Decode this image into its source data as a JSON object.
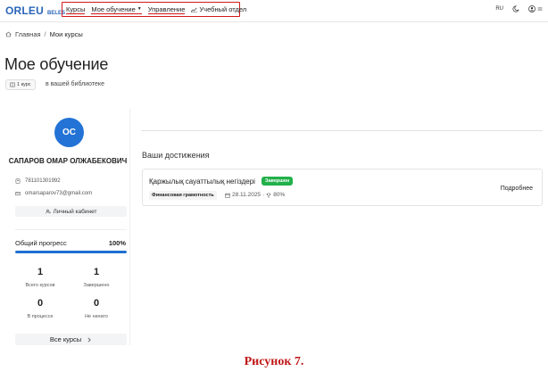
{
  "header": {
    "logo_main": "ORLEU",
    "logo_sub": "BELES",
    "nav": [
      {
        "label": "Курсы"
      },
      {
        "label": "Мое обучение"
      },
      {
        "label": "Управление"
      },
      {
        "label": "Учебный отдел"
      }
    ],
    "lang": "RU",
    "icons": [
      "moon-icon",
      "user-icon",
      "menu-icon",
      "chevron-down-icon",
      "line-chart-icon",
      "home-icon"
    ]
  },
  "breadcrumb": {
    "home": "Главная",
    "separator": "/",
    "current": "Мои курсы"
  },
  "page": {
    "title": "Мое обучение",
    "courses_chip": "1 курс",
    "library_text": "в вашей библиотеке"
  },
  "profile": {
    "initials": "ОС",
    "name": "САПАРОВ ОМАР ОЛЖАБЕКОВИЧ",
    "phone": "781101301992",
    "email": "omarsaparov73@gmail.com",
    "cabinet_button": "Личный кабинет",
    "progress_label": "Общий прогресс",
    "progress_text": "100%",
    "progress_value": 100,
    "stats": [
      {
        "value": "1",
        "label": "Всего курсов"
      },
      {
        "value": "1",
        "label": "Завершено"
      },
      {
        "value": "0",
        "label": "В процессе"
      },
      {
        "value": "0",
        "label": "Не начато"
      }
    ],
    "all_courses_button": "Все курсы"
  },
  "achievements": {
    "title": "Ваши достижения",
    "items": [
      {
        "course": "Қаржылық сауаттылық негіздері",
        "status": "Завершен",
        "category": "Финансовая грамотность",
        "date": "28.11.2025",
        "dot": "·",
        "score": "80%",
        "more": "Подробнее"
      }
    ]
  },
  "caption": "Рисунок 7.",
  "colors": {
    "brand": "#2a66b8",
    "accent": "#1f6fd1",
    "success": "#22b04a",
    "annotation": "#d01818"
  }
}
